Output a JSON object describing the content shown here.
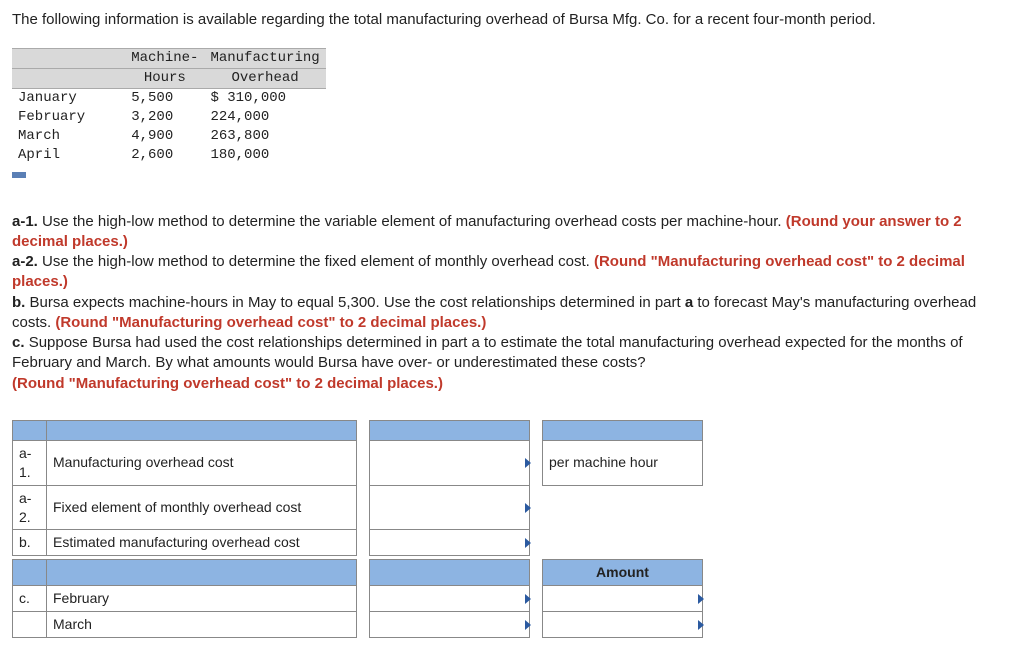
{
  "intro": "The following information is available regarding the total manufacturing overhead of Bursa Mfg. Co. for a recent four-month period.",
  "data_header": {
    "col1a": "Machine-",
    "col1b": "Hours",
    "col2a": "Manufacturing",
    "col2b": "Overhead"
  },
  "data_rows": [
    {
      "month": "January",
      "hours": "5,500",
      "oh": "$ 310,000"
    },
    {
      "month": "February",
      "hours": "3,200",
      "oh": "224,000"
    },
    {
      "month": "March",
      "hours": "4,900",
      "oh": "263,800"
    },
    {
      "month": "April",
      "hours": "2,600",
      "oh": "180,000"
    }
  ],
  "q": {
    "a1_pre": "a-1. ",
    "a1_txt": "Use the high-low method to determine the variable element of manufacturing overhead costs per machine-hour. ",
    "a1_red": "(Round your answer to 2 decimal places.)",
    "a2_pre": "a-2. ",
    "a2_txt": "Use the high-low method to determine the fixed element of monthly overhead cost. ",
    "a2_red": "(Round \"Manufacturing overhead cost\" to 2 decimal places.)",
    "b_pre": "b. ",
    "b_txt1": "Bursa expects machine-hours in May to equal 5,300. Use the cost relationships determined in part ",
    "b_bold": "a",
    "b_txt2": " to forecast May's manufacturing overhead costs. ",
    "b_red": "(Round \"Manufacturing overhead cost\" to 2 decimal places.)",
    "c_pre": "c. ",
    "c_txt": "Suppose Bursa had used the cost relationships determined in part a to estimate the total manufacturing overhead expected for the months of February and March. By what amounts would Bursa have over- or underestimated these costs? ",
    "c_red": "(Round \"Manufacturing overhead cost\" to 2 decimal places.)"
  },
  "ans": {
    "a1_lbl": "a-1.",
    "a1_desc": "Manufacturing overhead cost",
    "a1_unit": "per machine hour",
    "a2_lbl": "a-2.",
    "a2_desc": "Fixed element of monthly overhead cost",
    "b_lbl": "b.",
    "b_desc": "Estimated manufacturing overhead cost",
    "amount_hdr": "Amount",
    "c_lbl": "c.",
    "c_feb": "February",
    "c_mar": "March"
  }
}
